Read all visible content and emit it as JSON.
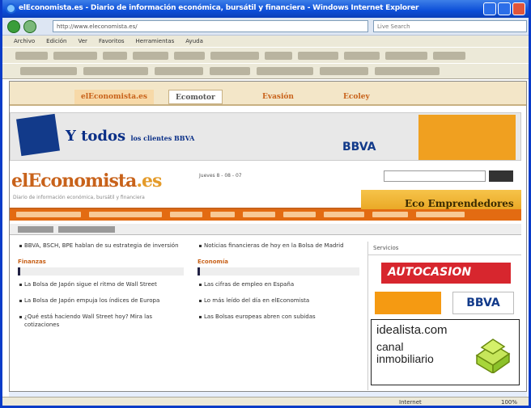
{
  "browser": {
    "window_title": "elEconomista.es - Diario de información económica, bursátil y financiera - Windows Internet Explorer",
    "address": "http://www.eleconomista.es/",
    "search_placeholder": "Live Search",
    "menu": [
      "Archivo",
      "Edición",
      "Ver",
      "Favoritos",
      "Herramientas",
      "Ayuda"
    ],
    "status_zone": "Internet",
    "status_zoom": "100%"
  },
  "site": {
    "tabs": [
      {
        "label": "elEconomista.es",
        "color": "#c8621a"
      },
      {
        "label": "Ecomotor",
        "color": "#555555"
      },
      {
        "label": "Evasión",
        "color": "#c8621a"
      },
      {
        "label": "Ecoley",
        "color": "#c8621a"
      }
    ],
    "ad_text": "Y todos",
    "ad_sub": "los clientes BBVA",
    "ad_brand": "BBVA",
    "logo_main": "elEconomista",
    "logo_suffix": ".es",
    "tagline": "Diario de información económica, bursátil y financiera",
    "date_line": "Jueves 8 - 08 - 07",
    "eco_banner": "Eco Emprendedores",
    "col_left": {
      "items_top": [
        "BBVA, BSCH, BPE hablan de su estrategia de inversión"
      ],
      "section": "Finanzas",
      "items": [
        "La Bolsa de Japón sigue el ritmo de Wall Street",
        "La Bolsa de Japón empuja los índices de Europa",
        "¿Qué está haciendo Wall Street hoy? Mira las cotizaciones"
      ]
    },
    "col_mid": {
      "items_top": [
        "Noticias financieras de hoy en la Bolsa de Madrid"
      ],
      "section": "Economía",
      "items": [
        "Las cifras de empleo en España",
        "Lo más leído del día en elEconomista",
        "Las Bolsas europeas abren con subidas"
      ]
    },
    "right": {
      "header": "Servicios",
      "autocasion": "AUTOCASION",
      "bbva": "BBVA",
      "idealista_title": "idealista.com",
      "idealista_sub1": "canal",
      "idealista_sub2": "inmobiliario",
      "idealista_color": "#a7d63a"
    }
  }
}
